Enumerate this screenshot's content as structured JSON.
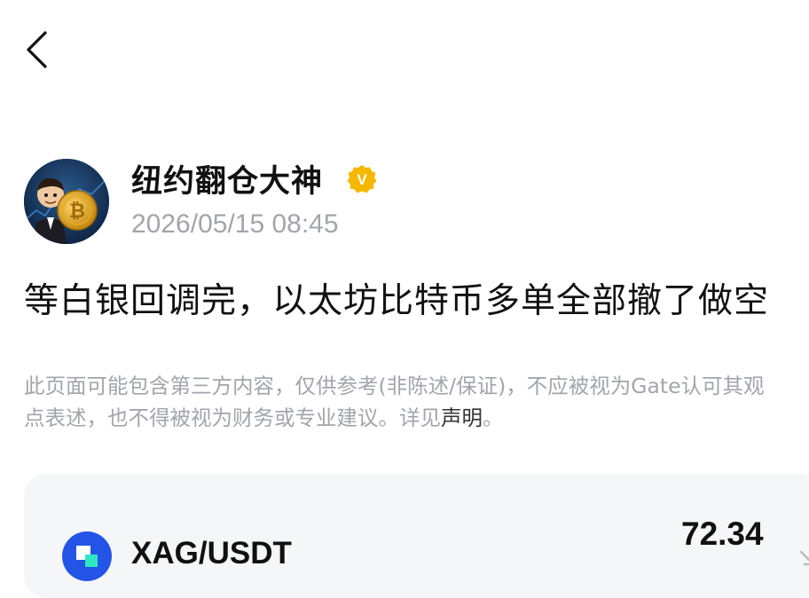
{
  "nav": {
    "back_icon": "chevron-left-icon"
  },
  "author": {
    "name": "纽约翻仓大神",
    "verified_icon": "verified-v-badge-icon",
    "verified_letter": "V",
    "verified_color": "#f5b800",
    "timestamp": "2026/05/15 08:45"
  },
  "post": {
    "text": "等白银回调完，以太坊比特币多单全部撤了做空"
  },
  "disclaimer": {
    "line1": "此页面可能包含第三方内容，仅供参考(非陈述/保证)，不应被视为Gate认可其观",
    "line2_prefix": "点表述，也不得被视为财务或专业建议。详见",
    "link_text": "声明",
    "line2_suffix": "。"
  },
  "ticker": {
    "symbol": "XAG/USDT",
    "price": "72.34",
    "icon": "gate-logo-icon",
    "brand_color": "#2354e6"
  }
}
